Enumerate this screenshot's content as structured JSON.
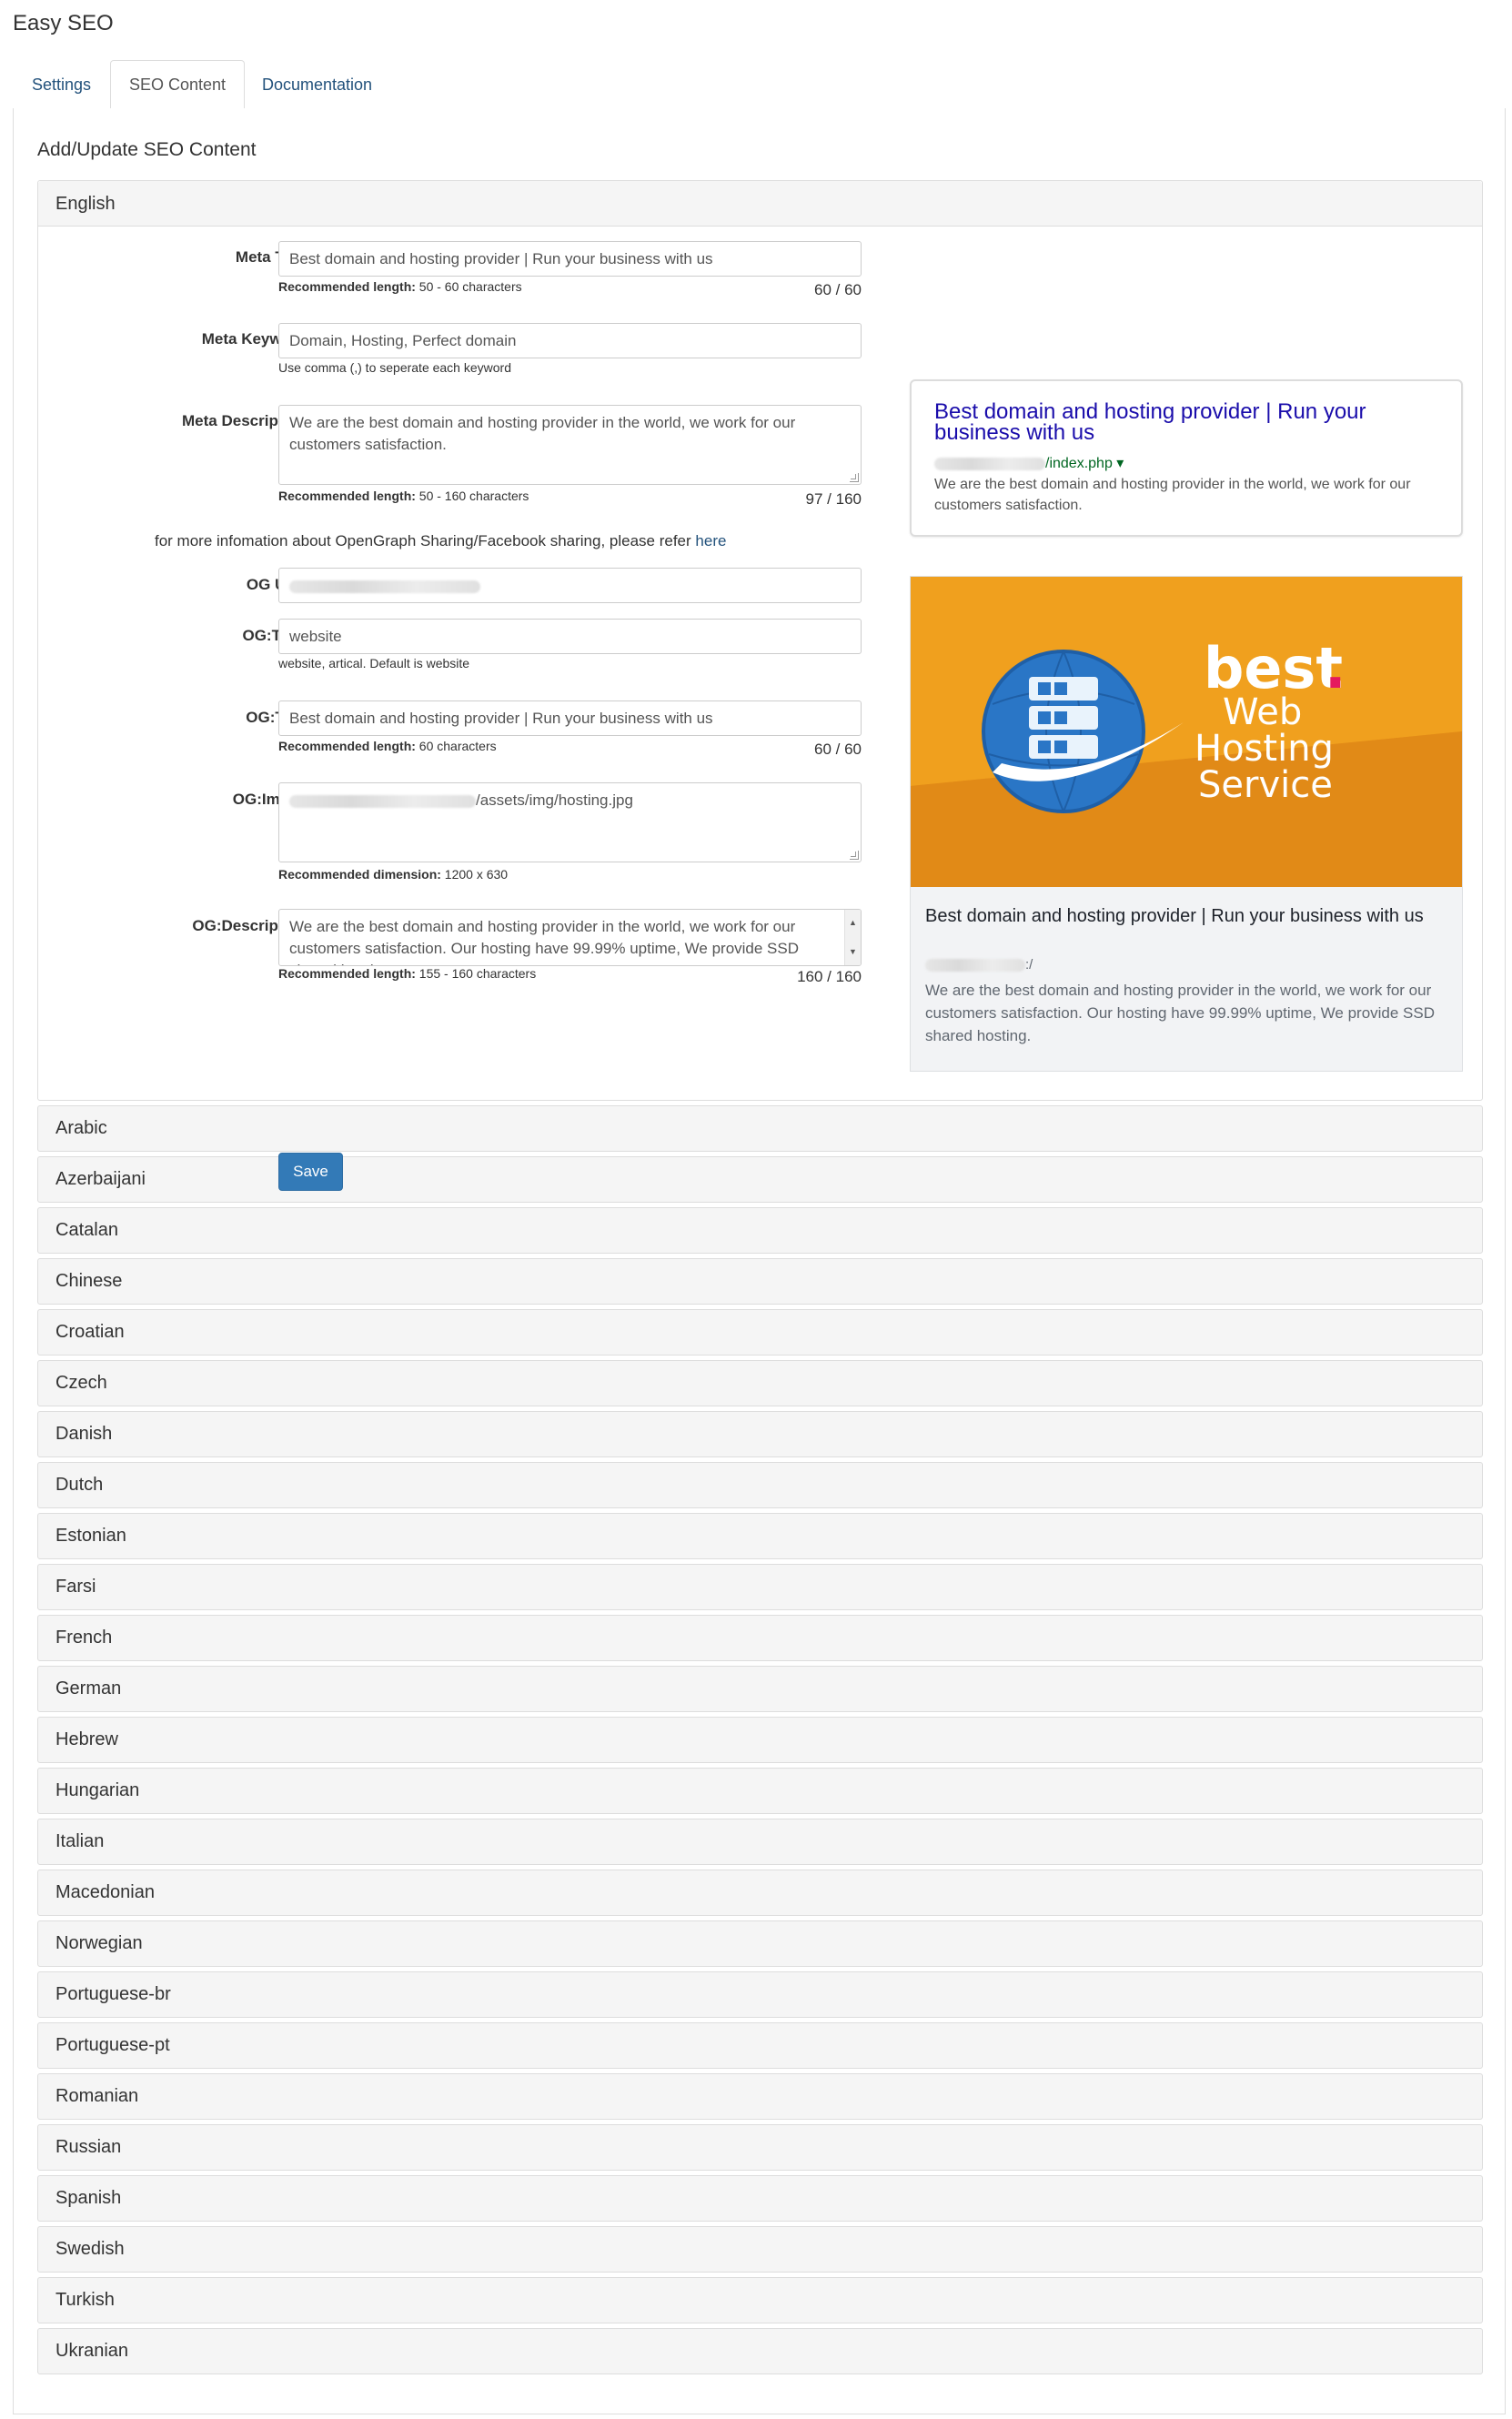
{
  "app": {
    "title": "Easy SEO"
  },
  "tabs": [
    {
      "label": "Settings",
      "active": false
    },
    {
      "label": "SEO Content",
      "active": true
    },
    {
      "label": "Documentation",
      "active": false
    }
  ],
  "section": {
    "heading": "Add/Update SEO Content"
  },
  "open_language": "English",
  "form": {
    "meta_title": {
      "label": "Meta Title",
      "value": "Best domain and hosting provider | Run your business with us",
      "help_bold": "Recommended length:",
      "help_text": " 50 - 60 characters",
      "counter": "60 / 60"
    },
    "meta_keyword": {
      "label": "Meta Keyword",
      "value": "Domain, Hosting, Perfect domain",
      "help_text": "Use comma (,) to seperate each keyword"
    },
    "meta_description": {
      "label": "Meta Description",
      "value": "We are the best domain and hosting provider in the world, we work for our customers satisfaction.",
      "help_bold": "Recommended length:",
      "help_text": " 50 - 160 characters",
      "counter": "97 / 160"
    },
    "og_info": {
      "text": "for more infomation about OpenGraph Sharing/Facebook sharing, please refer ",
      "link": "here"
    },
    "og_url": {
      "label": "OG URL",
      "value": ""
    },
    "og_type": {
      "label": "OG:Type",
      "value": "website",
      "help_text": "website, artical. Default is website"
    },
    "og_title": {
      "label": "OG:Title",
      "value": "Best domain and hosting provider | Run your business with us",
      "help_bold": "Recommended length:",
      "help_text": " 60 characters",
      "counter": "60 / 60"
    },
    "og_image": {
      "label": "OG:Image",
      "value_suffix": "/assets/img/hosting.jpg",
      "help_bold": "Recommended dimension:",
      "help_text": " 1200 x 630"
    },
    "og_description": {
      "label": "OG:Description",
      "value": "We are the best domain and hosting provider in the world, we work for our customers satisfaction. Our hosting have 99.99% uptime, We provide SSD shared hosting.",
      "help_bold": "Recommended length:",
      "help_text": " 155 - 160 characters",
      "counter": "160 / 160"
    },
    "save_label": "Save"
  },
  "serp_preview": {
    "title": "Best domain and hosting provider | Run your business with us",
    "url_suffix": "/index.php",
    "url_caret": "▾",
    "description": "We are the best domain and hosting provider in the world, we work for our customers satisfaction."
  },
  "og_preview": {
    "image_text_1": "best",
    "image_dot": ".",
    "image_text_2": "Web",
    "image_text_3": "Hosting",
    "image_text_4": "Service",
    "title": "Best domain and hosting provider | Run your business with us",
    "domain_suffix": ":/",
    "description": "We are the best domain and hosting provider in the world, we work for our customers satisfaction. Our hosting have 99.99% uptime, We provide SSD shared hosting."
  },
  "languages": [
    "Arabic",
    "Azerbaijani",
    "Catalan",
    "Chinese",
    "Croatian",
    "Czech",
    "Danish",
    "Dutch",
    "Estonian",
    "Farsi",
    "French",
    "German",
    "Hebrew",
    "Hungarian",
    "Italian",
    "Macedonian",
    "Norwegian",
    "Portuguese-br",
    "Portuguese-pt",
    "Romanian",
    "Russian",
    "Spanish",
    "Swedish",
    "Turkish",
    "Ukranian"
  ],
  "colors": {
    "link": "#23527c",
    "primary_button": "#337ab7",
    "serp_title": "#1a0dab",
    "serp_url": "#006621",
    "og_orange": "#f0a01e"
  }
}
